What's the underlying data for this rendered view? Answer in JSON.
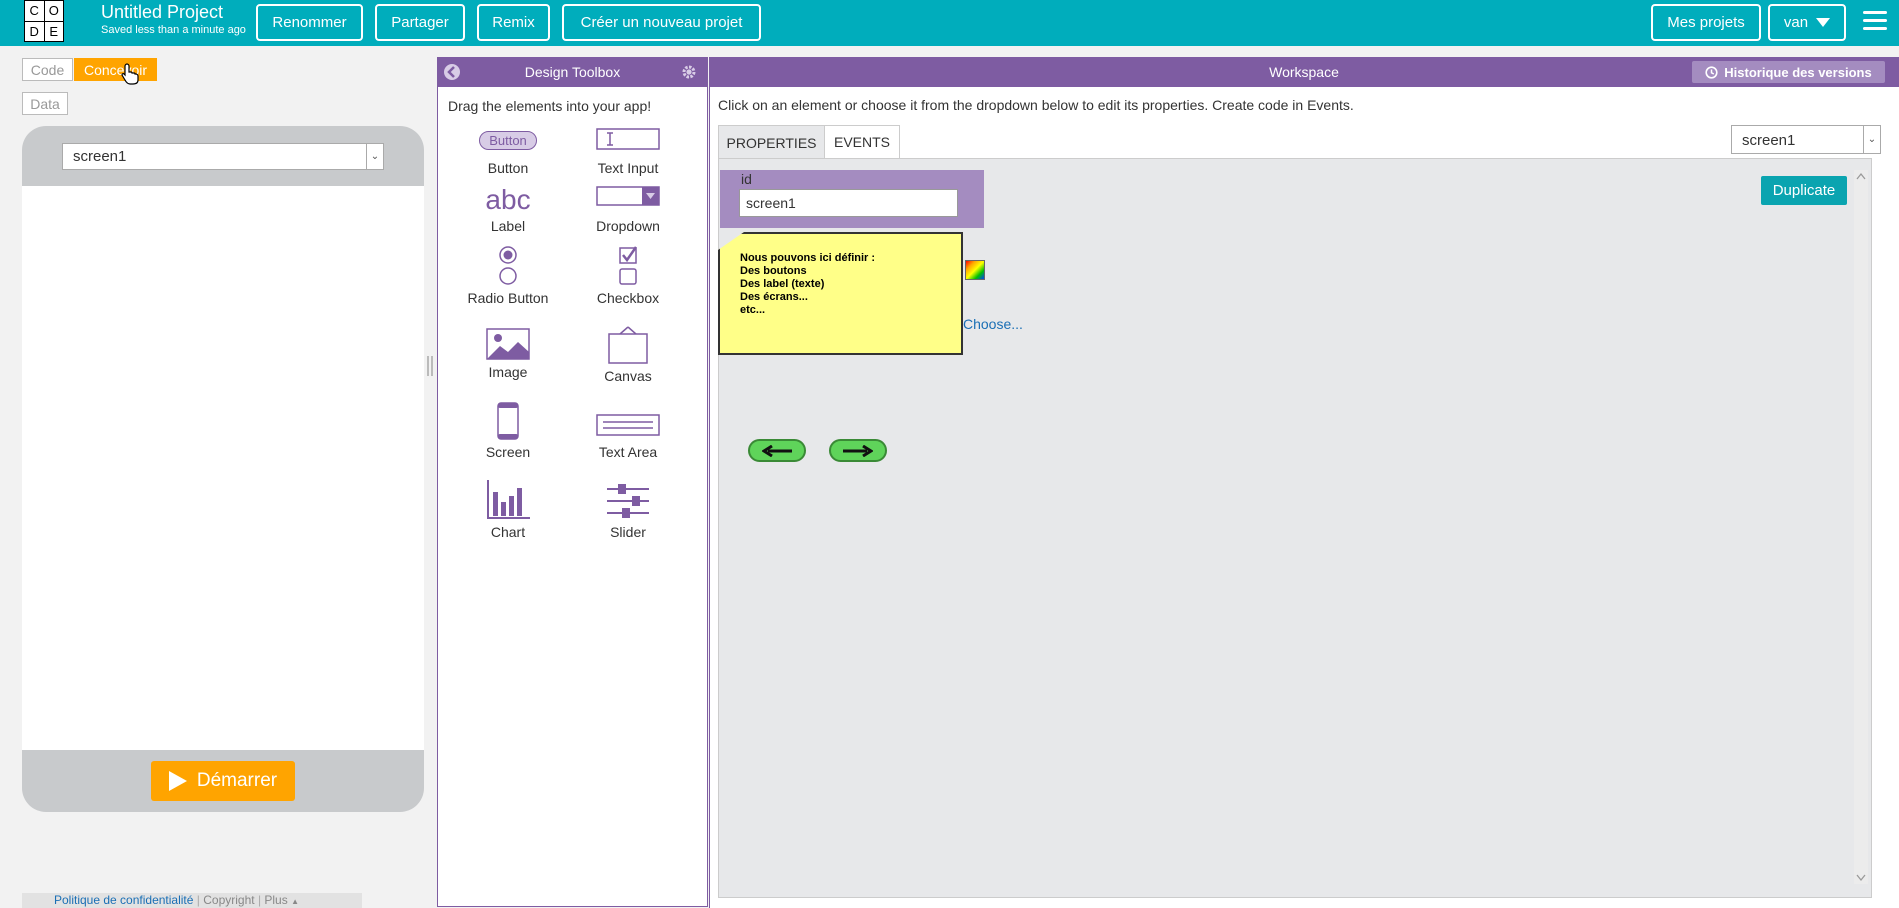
{
  "header": {
    "logo_letters": [
      "C",
      "O",
      "D",
      "E"
    ],
    "project_title": "Untitled Project",
    "save_status": "Saved less than a minute ago",
    "buttons": {
      "rename": "Renommer",
      "share": "Partager",
      "remix": "Remix",
      "new_project": "Créer un nouveau projet",
      "my_projects": "Mes projets",
      "user": "van"
    }
  },
  "left_panel": {
    "toggles": {
      "code": "Code",
      "design": "Concevoir",
      "data": "Data"
    },
    "screen_select": "screen1",
    "run_button": "Démarrer"
  },
  "footer": {
    "privacy": "Politique de confidentialité",
    "copyright": "Copyright",
    "more": "Plus"
  },
  "toolbox": {
    "title": "Design Toolbox",
    "instruction": "Drag the elements into your app!",
    "button_icon_text": "Button",
    "label_icon_text": "abc",
    "items": [
      {
        "label": "Button",
        "icon": "button-element-icon"
      },
      {
        "label": "Text Input",
        "icon": "text-input-icon"
      },
      {
        "label": "Label",
        "icon": "label-icon"
      },
      {
        "label": "Dropdown",
        "icon": "dropdown-icon"
      },
      {
        "label": "Radio Button",
        "icon": "radio-button-icon"
      },
      {
        "label": "Checkbox",
        "icon": "checkbox-icon"
      },
      {
        "label": "Image",
        "icon": "image-icon"
      },
      {
        "label": "Canvas",
        "icon": "canvas-icon"
      },
      {
        "label": "Screen",
        "icon": "screen-icon"
      },
      {
        "label": "Text Area",
        "icon": "text-area-icon"
      },
      {
        "label": "Chart",
        "icon": "chart-icon"
      },
      {
        "label": "Slider",
        "icon": "slider-icon"
      }
    ]
  },
  "workspace": {
    "title": "Workspace",
    "version_history": "Historique des versions",
    "instruction": "Click on an element or choose it from the dropdown below to edit its properties. Create code in Events.",
    "tabs": {
      "properties": "PROPERTIES",
      "events": "EVENTS"
    },
    "element_select": "screen1",
    "duplicate": "Duplicate",
    "id_label": "id",
    "id_value": "screen1",
    "choose_link": "Choose...",
    "note_lines": [
      "Nous pouvons ici définir :",
      "Des boutons",
      "Des label (texte)",
      "Des écrans...",
      "etc..."
    ]
  },
  "colors": {
    "header_bg": "#00adbc",
    "purple": "#7e5ca2",
    "orange": "#ffa400",
    "teal_button": "#0aa4b0"
  }
}
